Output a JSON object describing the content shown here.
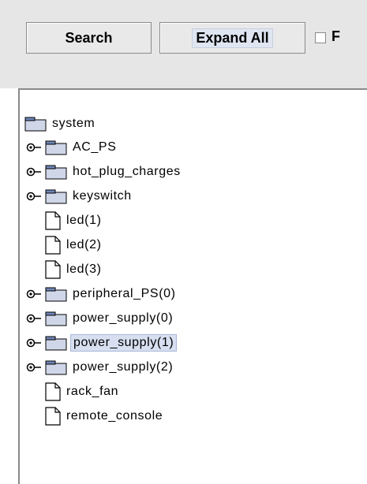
{
  "toolbar": {
    "search_label": "Search",
    "expand_all_label": "Expand All",
    "checkbox_label": "F"
  },
  "tree": {
    "root": "system",
    "items": [
      {
        "label": "AC_PS",
        "kind": "folder",
        "expandable": true,
        "selected": false
      },
      {
        "label": "hot_plug_charges",
        "kind": "folder",
        "expandable": true,
        "selected": false
      },
      {
        "label": "keyswitch",
        "kind": "folder",
        "expandable": true,
        "selected": false
      },
      {
        "label": "led(1)",
        "kind": "file",
        "expandable": false,
        "selected": false
      },
      {
        "label": "led(2)",
        "kind": "file",
        "expandable": false,
        "selected": false
      },
      {
        "label": "led(3)",
        "kind": "file",
        "expandable": false,
        "selected": false
      },
      {
        "label": "peripheral_PS(0)",
        "kind": "folder",
        "expandable": true,
        "selected": false
      },
      {
        "label": "power_supply(0)",
        "kind": "folder",
        "expandable": true,
        "selected": false
      },
      {
        "label": "power_supply(1)",
        "kind": "folder",
        "expandable": true,
        "selected": true
      },
      {
        "label": "power_supply(2)",
        "kind": "folder",
        "expandable": true,
        "selected": false
      },
      {
        "label": "rack_fan",
        "kind": "file",
        "expandable": false,
        "selected": false
      },
      {
        "label": "remote_console",
        "kind": "file",
        "expandable": false,
        "selected": false
      }
    ]
  },
  "colors": {
    "toolbar_bg": "#e6e6e6",
    "folder_fill": "#cfd6e8",
    "folder_tab": "#6f86b8",
    "selection_bg": "#d7dff0"
  }
}
